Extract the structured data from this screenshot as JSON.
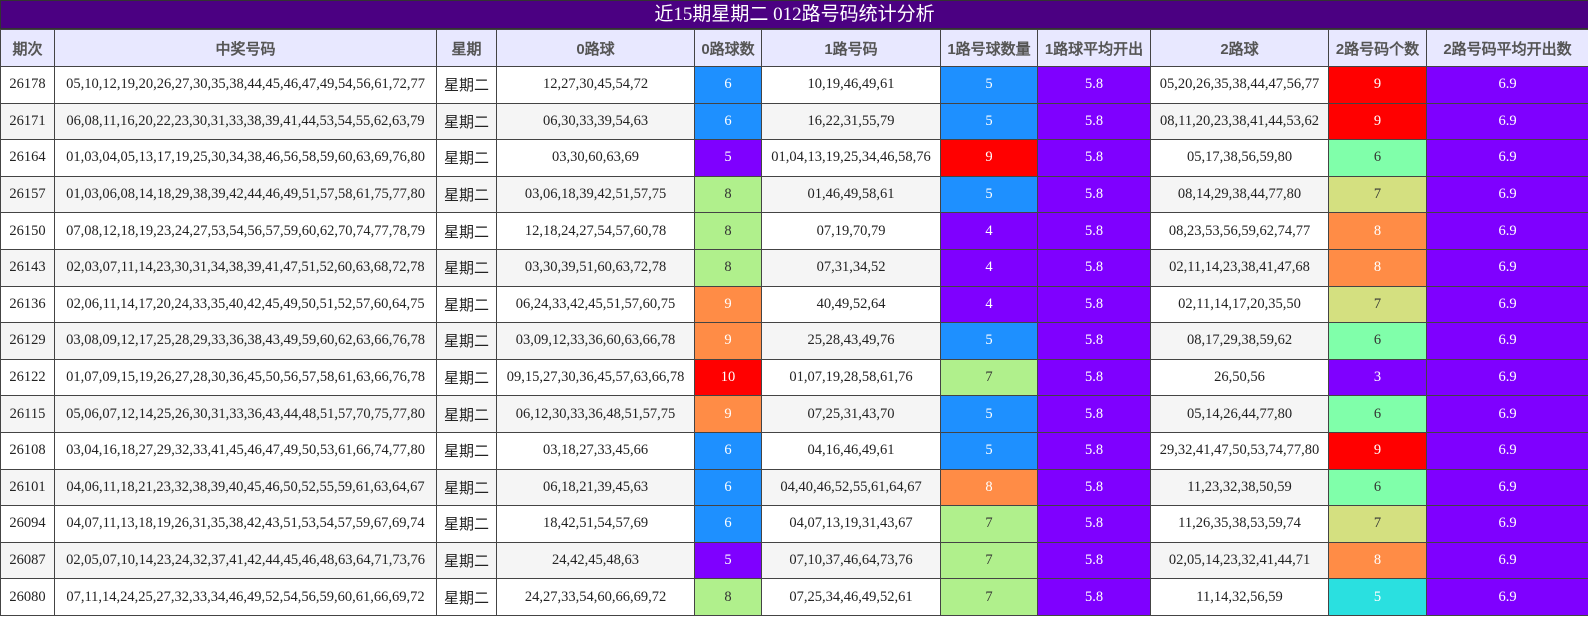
{
  "title": "近15期星期二 012路号码统计分析",
  "headers": [
    "期次",
    "中奖号码",
    "星期",
    "0路球",
    "0路球数",
    "1路号码",
    "1路号球数量",
    "1路球平均开出",
    "2路球",
    "2路号码个数",
    "2路号码平均开出数"
  ],
  "colors": {
    "purple": "#7f00ff",
    "blue": "#1e90ff",
    "red": "#ff0000",
    "green": "#b0f08c",
    "orange": "#ff8c46",
    "mint": "#80ffaa",
    "olive": "#d4e080",
    "cyan": "#2ae0e0"
  },
  "rows": [
    {
      "period": "26178",
      "numbers": "05,10,12,19,20,26,27,30,35,38,44,45,46,47,49,54,56,61,72,77",
      "week": "星期二",
      "r0": "12,27,30,45,54,72",
      "r0c": "6",
      "r0color": "blue",
      "r1": "10,19,46,49,61",
      "r1c": "5",
      "r1color": "blue",
      "r1avg": "5.8",
      "r2": "05,20,26,35,38,44,47,56,77",
      "r2c": "9",
      "r2color": "red",
      "r2avg": "6.9"
    },
    {
      "period": "26171",
      "numbers": "06,08,11,16,20,22,23,30,31,33,38,39,41,44,53,54,55,62,63,79",
      "week": "星期二",
      "r0": "06,30,33,39,54,63",
      "r0c": "6",
      "r0color": "blue",
      "r1": "16,22,31,55,79",
      "r1c": "5",
      "r1color": "blue",
      "r1avg": "5.8",
      "r2": "08,11,20,23,38,41,44,53,62",
      "r2c": "9",
      "r2color": "red",
      "r2avg": "6.9"
    },
    {
      "period": "26164",
      "numbers": "01,03,04,05,13,17,19,25,30,34,38,46,56,58,59,60,63,69,76,80",
      "week": "星期二",
      "r0": "03,30,60,63,69",
      "r0c": "5",
      "r0color": "purple",
      "r1": "01,04,13,19,25,34,46,58,76",
      "r1c": "9",
      "r1color": "red",
      "r1avg": "5.8",
      "r2": "05,17,38,56,59,80",
      "r2c": "6",
      "r2color": "mint",
      "r2avg": "6.9"
    },
    {
      "period": "26157",
      "numbers": "01,03,06,08,14,18,29,38,39,42,44,46,49,51,57,58,61,75,77,80",
      "week": "星期二",
      "r0": "03,06,18,39,42,51,57,75",
      "r0c": "8",
      "r0color": "green",
      "r1": "01,46,49,58,61",
      "r1c": "5",
      "r1color": "blue",
      "r1avg": "5.8",
      "r2": "08,14,29,38,44,77,80",
      "r2c": "7",
      "r2color": "olive",
      "r2avg": "6.9"
    },
    {
      "period": "26150",
      "numbers": "07,08,12,18,19,23,24,27,53,54,56,57,59,60,62,70,74,77,78,79",
      "week": "星期二",
      "r0": "12,18,24,27,54,57,60,78",
      "r0c": "8",
      "r0color": "green",
      "r1": "07,19,70,79",
      "r1c": "4",
      "r1color": "purple",
      "r1avg": "5.8",
      "r2": "08,23,53,56,59,62,74,77",
      "r2c": "8",
      "r2color": "orange",
      "r2avg": "6.9"
    },
    {
      "period": "26143",
      "numbers": "02,03,07,11,14,23,30,31,34,38,39,41,47,51,52,60,63,68,72,78",
      "week": "星期二",
      "r0": "03,30,39,51,60,63,72,78",
      "r0c": "8",
      "r0color": "green",
      "r1": "07,31,34,52",
      "r1c": "4",
      "r1color": "purple",
      "r1avg": "5.8",
      "r2": "02,11,14,23,38,41,47,68",
      "r2c": "8",
      "r2color": "orange",
      "r2avg": "6.9"
    },
    {
      "period": "26136",
      "numbers": "02,06,11,14,17,20,24,33,35,40,42,45,49,50,51,52,57,60,64,75",
      "week": "星期二",
      "r0": "06,24,33,42,45,51,57,60,75",
      "r0c": "9",
      "r0color": "orange",
      "r1": "40,49,52,64",
      "r1c": "4",
      "r1color": "purple",
      "r1avg": "5.8",
      "r2": "02,11,14,17,20,35,50",
      "r2c": "7",
      "r2color": "olive",
      "r2avg": "6.9"
    },
    {
      "period": "26129",
      "numbers": "03,08,09,12,17,25,28,29,33,36,38,43,49,59,60,62,63,66,76,78",
      "week": "星期二",
      "r0": "03,09,12,33,36,60,63,66,78",
      "r0c": "9",
      "r0color": "orange",
      "r1": "25,28,43,49,76",
      "r1c": "5",
      "r1color": "blue",
      "r1avg": "5.8",
      "r2": "08,17,29,38,59,62",
      "r2c": "6",
      "r2color": "mint",
      "r2avg": "6.9"
    },
    {
      "period": "26122",
      "numbers": "01,07,09,15,19,26,27,28,30,36,45,50,56,57,58,61,63,66,76,78",
      "week": "星期二",
      "r0": "09,15,27,30,36,45,57,63,66,78",
      "r0c": "10",
      "r0color": "red",
      "r1": "01,07,19,28,58,61,76",
      "r1c": "7",
      "r1color": "green",
      "r1avg": "5.8",
      "r2": "26,50,56",
      "r2c": "3",
      "r2color": "purple",
      "r2avg": "6.9"
    },
    {
      "period": "26115",
      "numbers": "05,06,07,12,14,25,26,30,31,33,36,43,44,48,51,57,70,75,77,80",
      "week": "星期二",
      "r0": "06,12,30,33,36,48,51,57,75",
      "r0c": "9",
      "r0color": "orange",
      "r1": "07,25,31,43,70",
      "r1c": "5",
      "r1color": "blue",
      "r1avg": "5.8",
      "r2": "05,14,26,44,77,80",
      "r2c": "6",
      "r2color": "mint",
      "r2avg": "6.9"
    },
    {
      "period": "26108",
      "numbers": "03,04,16,18,27,29,32,33,41,45,46,47,49,50,53,61,66,74,77,80",
      "week": "星期二",
      "r0": "03,18,27,33,45,66",
      "r0c": "6",
      "r0color": "blue",
      "r1": "04,16,46,49,61",
      "r1c": "5",
      "r1color": "blue",
      "r1avg": "5.8",
      "r2": "29,32,41,47,50,53,74,77,80",
      "r2c": "9",
      "r2color": "red",
      "r2avg": "6.9"
    },
    {
      "period": "26101",
      "numbers": "04,06,11,18,21,23,32,38,39,40,45,46,50,52,55,59,61,63,64,67",
      "week": "星期二",
      "r0": "06,18,21,39,45,63",
      "r0c": "6",
      "r0color": "blue",
      "r1": "04,40,46,52,55,61,64,67",
      "r1c": "8",
      "r1color": "orange",
      "r1avg": "5.8",
      "r2": "11,23,32,38,50,59",
      "r2c": "6",
      "r2color": "mint",
      "r2avg": "6.9"
    },
    {
      "period": "26094",
      "numbers": "04,07,11,13,18,19,26,31,35,38,42,43,51,53,54,57,59,67,69,74",
      "week": "星期二",
      "r0": "18,42,51,54,57,69",
      "r0c": "6",
      "r0color": "blue",
      "r1": "04,07,13,19,31,43,67",
      "r1c": "7",
      "r1color": "green",
      "r1avg": "5.8",
      "r2": "11,26,35,38,53,59,74",
      "r2c": "7",
      "r2color": "olive",
      "r2avg": "6.9"
    },
    {
      "period": "26087",
      "numbers": "02,05,07,10,14,23,24,32,37,41,42,44,45,46,48,63,64,71,73,76",
      "week": "星期二",
      "r0": "24,42,45,48,63",
      "r0c": "5",
      "r0color": "purple",
      "r1": "07,10,37,46,64,73,76",
      "r1c": "7",
      "r1color": "green",
      "r1avg": "5.8",
      "r2": "02,05,14,23,32,41,44,71",
      "r2c": "8",
      "r2color": "orange",
      "r2avg": "6.9"
    },
    {
      "period": "26080",
      "numbers": "07,11,14,24,25,27,32,33,34,46,49,52,54,56,59,60,61,66,69,72",
      "week": "星期二",
      "r0": "24,27,33,54,60,66,69,72",
      "r0c": "8",
      "r0color": "green",
      "r1": "07,25,34,46,49,52,61",
      "r1c": "7",
      "r1color": "green",
      "r1avg": "5.8",
      "r2": "11,14,32,56,59",
      "r2c": "5",
      "r2color": "cyan",
      "r2avg": "6.9"
    }
  ]
}
